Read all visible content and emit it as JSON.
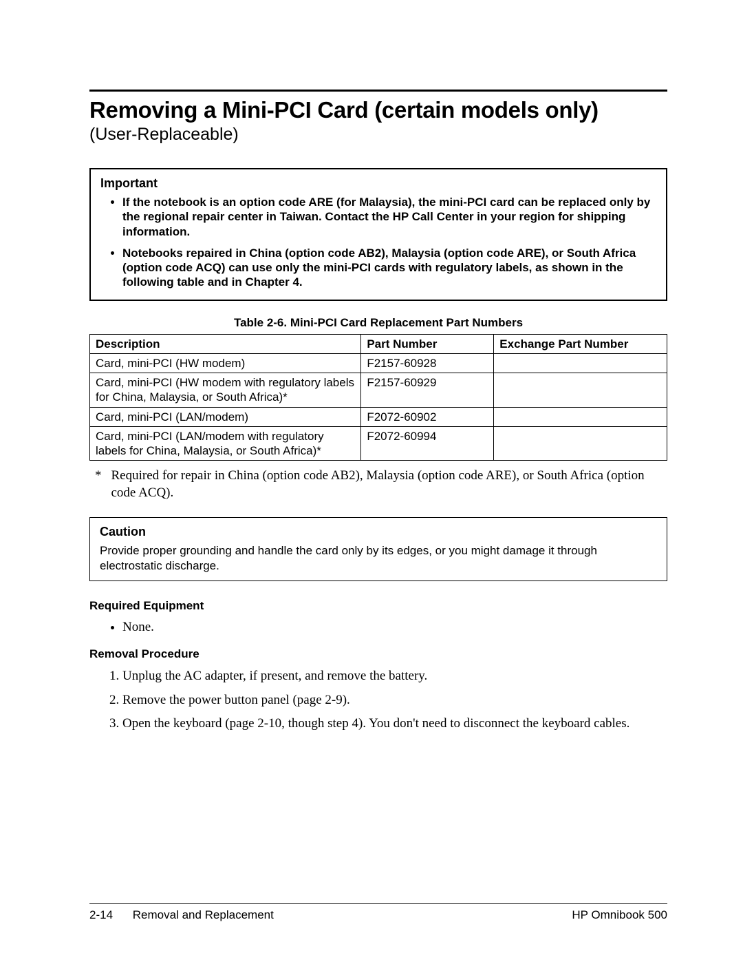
{
  "title": "Removing a Mini-PCI Card (certain models only)",
  "subtitle": "(User-Replaceable)",
  "important": {
    "heading": "Important",
    "items": [
      "If the notebook is an option code ARE (for Malaysia), the mini-PCI card can be replaced only by the regional repair center in Taiwan. Contact the HP Call Center in your region for shipping information.",
      "Notebooks repaired in China (option code AB2), Malaysia (option code ARE), or South Africa (option code ACQ) can use only the mini-PCI cards with regulatory labels, as shown in the following table and in Chapter 4."
    ]
  },
  "table": {
    "caption": "Table 2-6. Mini-PCI Card Replacement Part Numbers",
    "headers": {
      "desc": "Description",
      "pn": "Part Number",
      "epn": "Exchange Part Number"
    },
    "rows": [
      {
        "desc": "Card, mini-PCI (HW modem)",
        "pn": "F2157-60928",
        "epn": ""
      },
      {
        "desc": "Card, mini-PCI (HW modem with regulatory labels for China, Malaysia, or South Africa)*",
        "pn": "F2157-60929",
        "epn": ""
      },
      {
        "desc": "Card, mini-PCI (LAN/modem)",
        "pn": "F2072-60902",
        "epn": ""
      },
      {
        "desc": "Card, mini-PCI (LAN/modem with regulatory labels for China, Malaysia, or South Africa)*",
        "pn": "F2072-60994",
        "epn": ""
      }
    ]
  },
  "footnote": {
    "mark": "*",
    "text": "Required for repair in China (option code AB2), Malaysia (option code ARE), or South Africa (option code ACQ)."
  },
  "caution": {
    "heading": "Caution",
    "text": "Provide proper grounding and handle the card only by its edges, or you might damage it through electrostatic discharge."
  },
  "required_equipment": {
    "heading": "Required Equipment",
    "items": [
      "None."
    ]
  },
  "removal_procedure": {
    "heading": "Removal Procedure",
    "steps": [
      "Unplug the AC adapter, if present, and remove the battery.",
      "Remove the power button panel (page 2-9).",
      "Open the keyboard (page 2-10, though step 4). You don't need to disconnect the keyboard cables."
    ]
  },
  "footer": {
    "page": "2-14",
    "section": "Removal and Replacement",
    "product": "HP Omnibook 500"
  }
}
